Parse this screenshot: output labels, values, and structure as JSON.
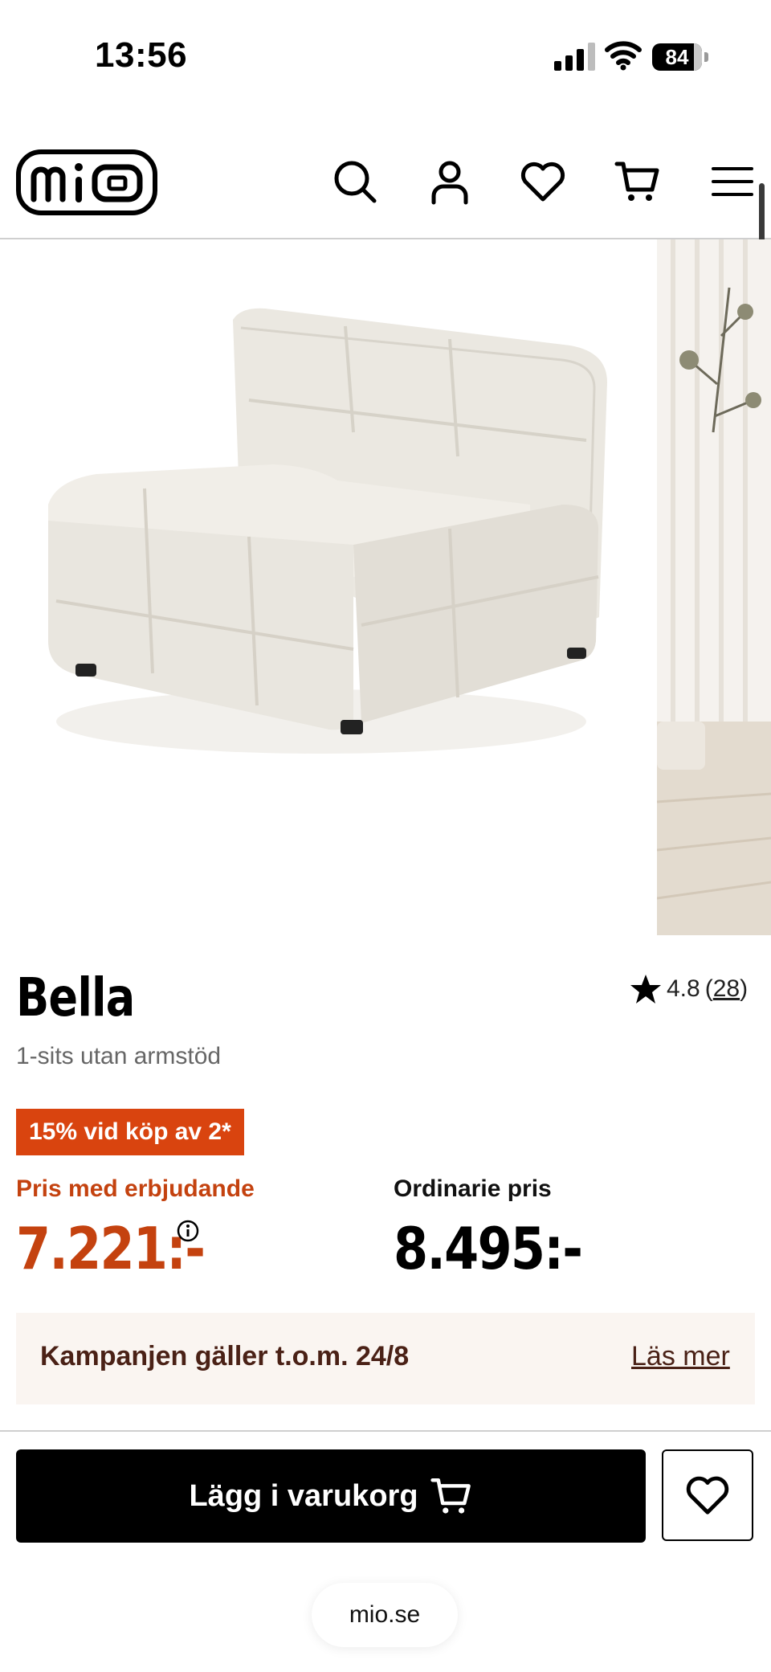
{
  "status_bar": {
    "time": "13:56",
    "battery": "84"
  },
  "header": {
    "logo_text": "mio",
    "icons": [
      "search-icon",
      "account-icon",
      "heart-icon",
      "cart-icon",
      "menu-icon"
    ]
  },
  "product": {
    "title": "Bella",
    "subtitle": "1-sits utan armstöd",
    "rating": "4.8",
    "review_count": "28",
    "promo_badge": "15% vid köp av 2*",
    "offer_label": "Pris med erbjudande",
    "offer_price": "7.221:-",
    "regular_label": "Ordinarie pris",
    "regular_price": "8.495:-"
  },
  "campaign": {
    "text": "Kampanjen gäller t.o.m. 24/8",
    "link": "Läs mer"
  },
  "actions": {
    "add_to_cart": "Lägg i varukorg"
  },
  "browser": {
    "url": "mio.se"
  },
  "colors": {
    "accent": "#d9440f",
    "price": "#c4420f",
    "campaign_bg": "#faf5f1",
    "campaign_text": "#4a2116"
  }
}
